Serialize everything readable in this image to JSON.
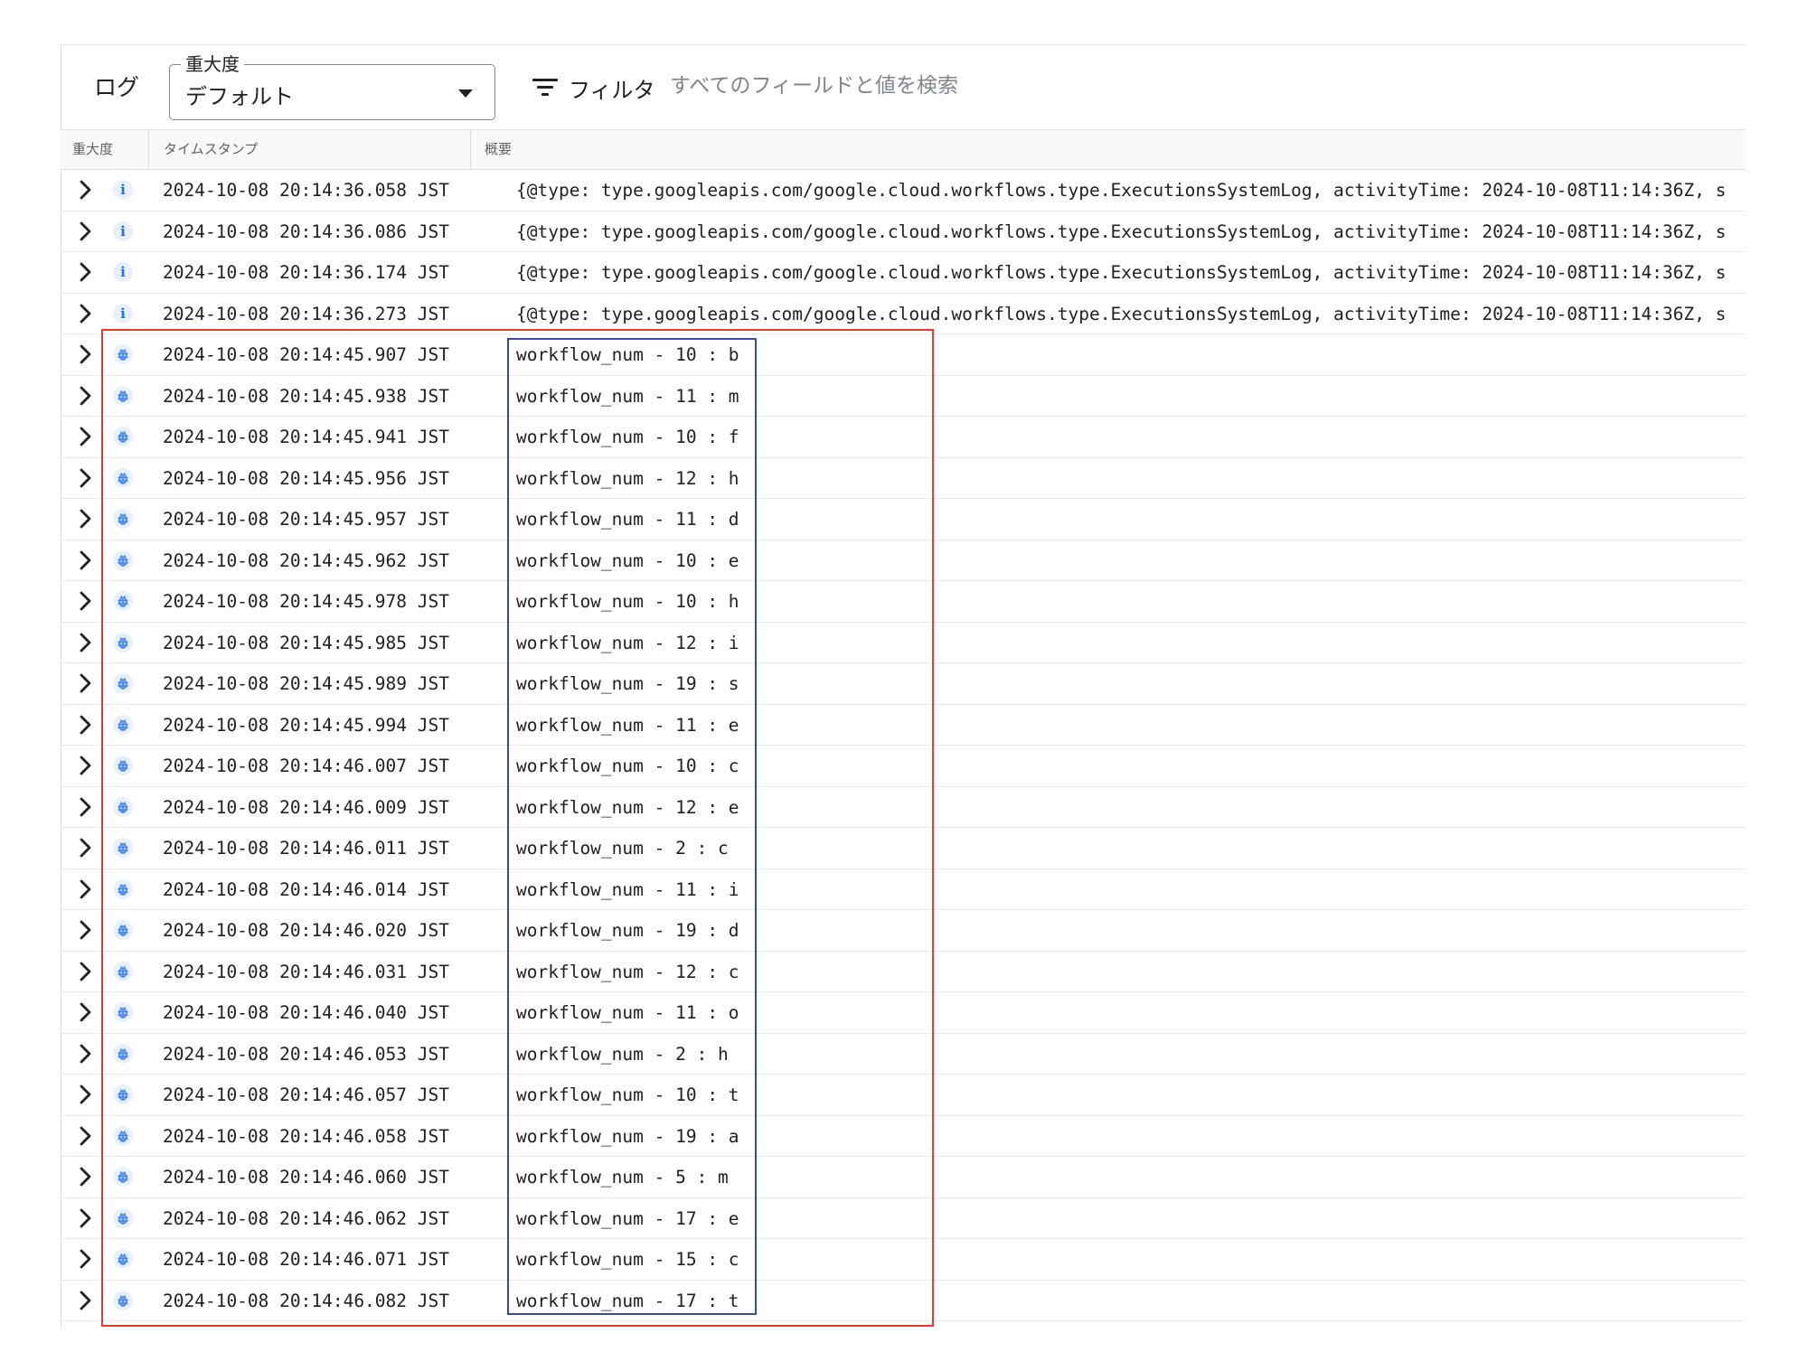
{
  "toolbar": {
    "log_label": "ログ",
    "severity_label": "重大度",
    "severity_value": "デフォルト",
    "filter_label": "フィルタ",
    "search_placeholder": "すべてのフィールドと値を検索"
  },
  "columns": {
    "severity": "重大度",
    "timestamp": "タイムスタンプ",
    "summary": "概要"
  },
  "colors": {
    "tab_indicator": "#1a73e8",
    "info_icon": "#1a73e8",
    "debug_icon": "#4285f4",
    "highlight_red": "#e53935",
    "highlight_blue": "#3949ab"
  },
  "rows": [
    {
      "severity": "info",
      "icon": "info-icon",
      "timestamp": "2024-10-08 20:14:36.058 JST",
      "summary": "{@type: type.googleapis.com/google.cloud.workflows.type.ExecutionsSystemLog, activityTime: 2024-10-08T11:14:36Z, s"
    },
    {
      "severity": "info",
      "icon": "info-icon",
      "timestamp": "2024-10-08 20:14:36.086 JST",
      "summary": "{@type: type.googleapis.com/google.cloud.workflows.type.ExecutionsSystemLog, activityTime: 2024-10-08T11:14:36Z, s"
    },
    {
      "severity": "info",
      "icon": "info-icon",
      "timestamp": "2024-10-08 20:14:36.174 JST",
      "summary": "{@type: type.googleapis.com/google.cloud.workflows.type.ExecutionsSystemLog, activityTime: 2024-10-08T11:14:36Z, s"
    },
    {
      "severity": "info",
      "icon": "info-icon",
      "timestamp": "2024-10-08 20:14:36.273 JST",
      "summary": "{@type: type.googleapis.com/google.cloud.workflows.type.ExecutionsSystemLog, activityTime: 2024-10-08T11:14:36Z, s"
    },
    {
      "severity": "debug",
      "icon": "bug-icon",
      "timestamp": "2024-10-08 20:14:45.907 JST",
      "summary": "workflow_num - 10 : b"
    },
    {
      "severity": "debug",
      "icon": "bug-icon",
      "timestamp": "2024-10-08 20:14:45.938 JST",
      "summary": "workflow_num - 11 : m"
    },
    {
      "severity": "debug",
      "icon": "bug-icon",
      "timestamp": "2024-10-08 20:14:45.941 JST",
      "summary": "workflow_num - 10 : f"
    },
    {
      "severity": "debug",
      "icon": "bug-icon",
      "timestamp": "2024-10-08 20:14:45.956 JST",
      "summary": "workflow_num - 12 : h"
    },
    {
      "severity": "debug",
      "icon": "bug-icon",
      "timestamp": "2024-10-08 20:14:45.957 JST",
      "summary": "workflow_num - 11 : d"
    },
    {
      "severity": "debug",
      "icon": "bug-icon",
      "timestamp": "2024-10-08 20:14:45.962 JST",
      "summary": "workflow_num - 10 : e"
    },
    {
      "severity": "debug",
      "icon": "bug-icon",
      "timestamp": "2024-10-08 20:14:45.978 JST",
      "summary": "workflow_num - 10 : h"
    },
    {
      "severity": "debug",
      "icon": "bug-icon",
      "timestamp": "2024-10-08 20:14:45.985 JST",
      "summary": "workflow_num - 12 : i"
    },
    {
      "severity": "debug",
      "icon": "bug-icon",
      "timestamp": "2024-10-08 20:14:45.989 JST",
      "summary": "workflow_num - 19 : s"
    },
    {
      "severity": "debug",
      "icon": "bug-icon",
      "timestamp": "2024-10-08 20:14:45.994 JST",
      "summary": "workflow_num - 11 : e"
    },
    {
      "severity": "debug",
      "icon": "bug-icon",
      "timestamp": "2024-10-08 20:14:46.007 JST",
      "summary": "workflow_num - 10 : c"
    },
    {
      "severity": "debug",
      "icon": "bug-icon",
      "timestamp": "2024-10-08 20:14:46.009 JST",
      "summary": "workflow_num - 12 : e"
    },
    {
      "severity": "debug",
      "icon": "bug-icon",
      "timestamp": "2024-10-08 20:14:46.011 JST",
      "summary": "workflow_num - 2 : c"
    },
    {
      "severity": "debug",
      "icon": "bug-icon",
      "timestamp": "2024-10-08 20:14:46.014 JST",
      "summary": "workflow_num - 11 : i"
    },
    {
      "severity": "debug",
      "icon": "bug-icon",
      "timestamp": "2024-10-08 20:14:46.020 JST",
      "summary": "workflow_num - 19 : d"
    },
    {
      "severity": "debug",
      "icon": "bug-icon",
      "timestamp": "2024-10-08 20:14:46.031 JST",
      "summary": "workflow_num - 12 : c"
    },
    {
      "severity": "debug",
      "icon": "bug-icon",
      "timestamp": "2024-10-08 20:14:46.040 JST",
      "summary": "workflow_num - 11 : o"
    },
    {
      "severity": "debug",
      "icon": "bug-icon",
      "timestamp": "2024-10-08 20:14:46.053 JST",
      "summary": "workflow_num - 2 : h"
    },
    {
      "severity": "debug",
      "icon": "bug-icon",
      "timestamp": "2024-10-08 20:14:46.057 JST",
      "summary": "workflow_num - 10 : t"
    },
    {
      "severity": "debug",
      "icon": "bug-icon",
      "timestamp": "2024-10-08 20:14:46.058 JST",
      "summary": "workflow_num - 19 : a"
    },
    {
      "severity": "debug",
      "icon": "bug-icon",
      "timestamp": "2024-10-08 20:14:46.060 JST",
      "summary": "workflow_num - 5 : m"
    },
    {
      "severity": "debug",
      "icon": "bug-icon",
      "timestamp": "2024-10-08 20:14:46.062 JST",
      "summary": "workflow_num - 17 : e"
    },
    {
      "severity": "debug",
      "icon": "bug-icon",
      "timestamp": "2024-10-08 20:14:46.071 JST",
      "summary": "workflow_num - 15 : c"
    },
    {
      "severity": "debug",
      "icon": "bug-icon",
      "timestamp": "2024-10-08 20:14:46.082 JST",
      "summary": "workflow_num - 17 : t"
    }
  ]
}
